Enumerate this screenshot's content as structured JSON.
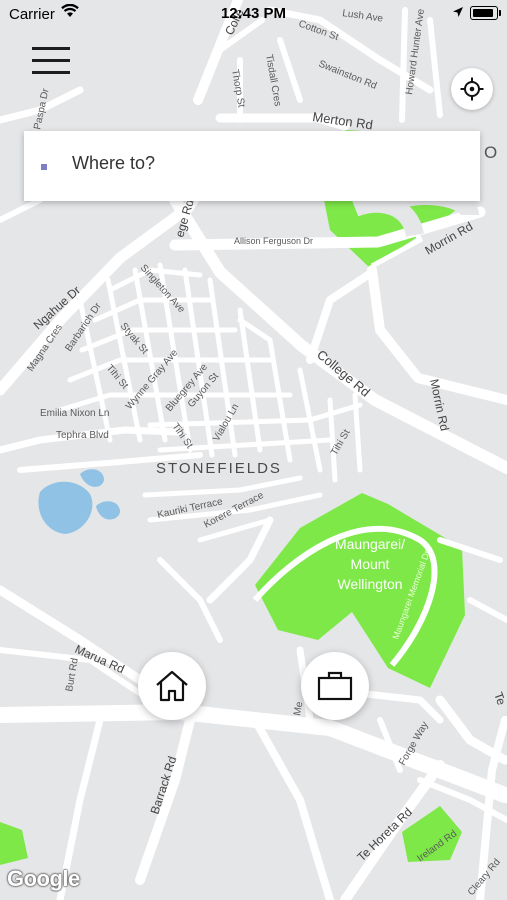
{
  "status_bar": {
    "carrier": "Carrier",
    "time": "12:43 PM"
  },
  "search": {
    "placeholder": "Where to?"
  },
  "buttons": {
    "home_icon": "home-icon",
    "work_icon": "briefcase-icon",
    "locate_icon": "crosshair-icon",
    "menu_icon": "hamburger-icon"
  },
  "map": {
    "suburb": "STONEFIELDS",
    "park_lines": [
      "Maungarei/",
      "Mount",
      "Wellington"
    ],
    "park_color": "#7ee848",
    "logo": "Google",
    "streets": {
      "lush": "Lush Ave",
      "cotton": "Cotton St",
      "howard": "Howard Hunter Ave",
      "thorp": "Thorp St",
      "tisdall": "Tisdall Cres",
      "swainston": "Swainston Rd",
      "merton": "Merton Rd",
      "collegeTop": "Colle",
      "spa": "Paspa Dr",
      "ege": "ege Rd",
      "allison": "Allison Ferguson Dr",
      "morrinTop": "Morrin Rd",
      "ngahue": "Ngahue Dr",
      "magna": "Magna Cres",
      "barbarich": "Barbarich Dr",
      "singleton": "Singleton Ave",
      "styak": "Styak St",
      "tihiA": "Tihi St",
      "wynne": "Wynne Gray Ave",
      "bluegrey": "Bluegrey Ave",
      "guyon": "Guyon St",
      "collegeMid": "College Rd",
      "morrinMid": "Morrin Rd",
      "emilia": "Emilia Nixon Ln",
      "tephra": "Tephra Blvd",
      "tihiB": "Tihi St",
      "vialou": "Vialou Ln",
      "tihiC": "Tihi St",
      "kauriki": "Kauriki Terrace",
      "korere": "Korere Terrace",
      "memorial": "Maungarei Memorial Dr",
      "marua": "Marua Rd",
      "burt": "Burt Rd",
      "forge": "Forge Way",
      "barrack": "Barrack Rd",
      "tehoreta": "Te Horeta Rd",
      "ireland": "Ireland Rd",
      "cleary": "Cleary Rd",
      "te": "Te",
      "me": "Me",
      "o": "O"
    }
  }
}
